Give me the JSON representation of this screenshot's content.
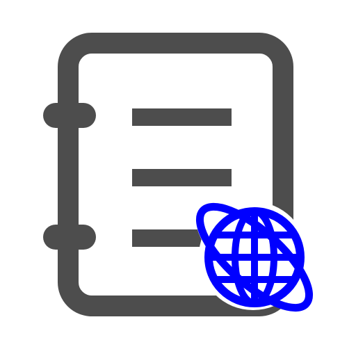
{
  "icon": {
    "name": "notebook-globe-icon",
    "colors": {
      "notebook": "#4d4d4d",
      "globe": "#0000ff",
      "background": "#ffffff"
    }
  }
}
